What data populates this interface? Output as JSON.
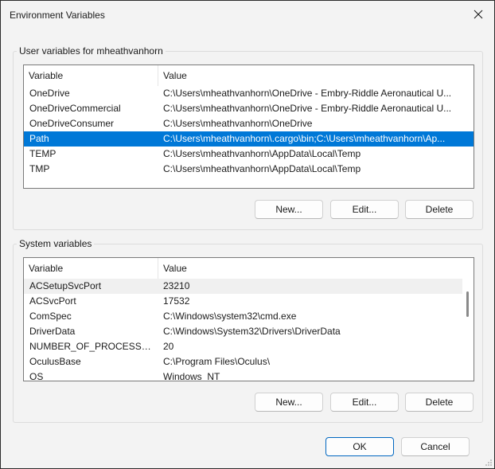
{
  "window": {
    "title": "Environment Variables"
  },
  "user_group": {
    "label": "User variables for mheathvanhorn",
    "columns": [
      "Variable",
      "Value"
    ],
    "rows": [
      {
        "variable": "OneDrive",
        "value": "C:\\Users\\mheathvanhorn\\OneDrive - Embry-Riddle Aeronautical U..."
      },
      {
        "variable": "OneDriveCommercial",
        "value": "C:\\Users\\mheathvanhorn\\OneDrive - Embry-Riddle Aeronautical U..."
      },
      {
        "variable": "OneDriveConsumer",
        "value": "C:\\Users\\mheathvanhorn\\OneDrive"
      },
      {
        "variable": "Path",
        "value": "C:\\Users\\mheathvanhorn\\.cargo\\bin;C:\\Users\\mheathvanhorn\\Ap..."
      },
      {
        "variable": "TEMP",
        "value": "C:\\Users\\mheathvanhorn\\AppData\\Local\\Temp"
      },
      {
        "variable": "TMP",
        "value": "C:\\Users\\mheathvanhorn\\AppData\\Local\\Temp"
      }
    ],
    "selected_row": "Path",
    "buttons": {
      "new": "New...",
      "edit": "Edit...",
      "delete": "Delete"
    }
  },
  "system_group": {
    "label": "System variables",
    "columns": [
      "Variable",
      "Value"
    ],
    "rows": [
      {
        "variable": "ACSetupSvcPort",
        "value": "23210"
      },
      {
        "variable": "ACSvcPort",
        "value": "17532"
      },
      {
        "variable": "ComSpec",
        "value": "C:\\Windows\\system32\\cmd.exe"
      },
      {
        "variable": "DriverData",
        "value": "C:\\Windows\\System32\\Drivers\\DriverData"
      },
      {
        "variable": "NUMBER_OF_PROCESSORS",
        "value": "20"
      },
      {
        "variable": "OculusBase",
        "value": "C:\\Program Files\\Oculus\\"
      },
      {
        "variable": "OS",
        "value": "Windows_NT"
      }
    ],
    "hovered_row": "ACSetupSvcPort",
    "buttons": {
      "new": "New...",
      "edit": "Edit...",
      "delete": "Delete"
    }
  },
  "dialog_buttons": {
    "ok": "OK",
    "cancel": "Cancel"
  },
  "colors": {
    "selection": "#0078d7",
    "accent_border": "#0067c0",
    "window_bg": "#f3f3f3"
  },
  "icons": {
    "close": "close-icon",
    "resize": "resize-grip-icon"
  }
}
